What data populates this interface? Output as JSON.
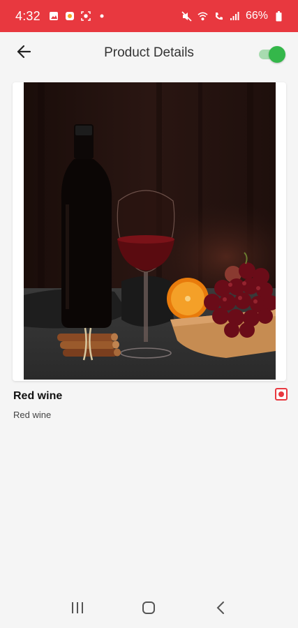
{
  "status_bar": {
    "time": "4:32",
    "battery": "66%",
    "bg_color": "#e8383f"
  },
  "header": {
    "title": "Product Details",
    "back_icon": "arrow-left-icon",
    "toggle_state": "on",
    "toggle_color": "#34b74a"
  },
  "product": {
    "name": "Red wine",
    "description": "Red wine",
    "image": "red-wine-bottle-glass-grapes-photo",
    "selected": true
  },
  "nav_bar": {
    "recents_icon": "recents-icon",
    "home_icon": "home-icon",
    "back_icon": "back-chevron-icon"
  }
}
